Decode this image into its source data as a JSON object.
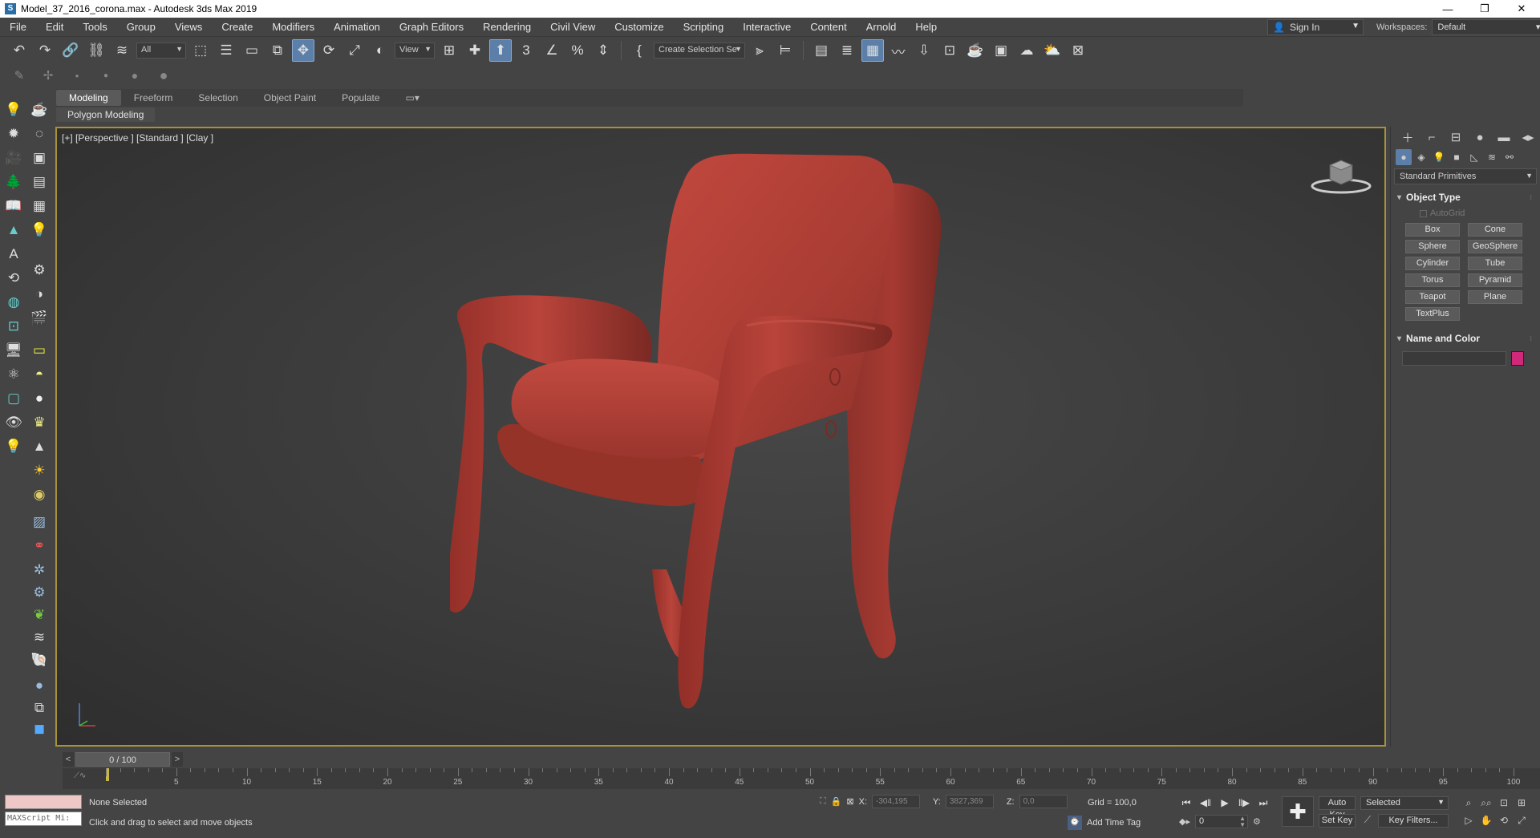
{
  "window": {
    "title": "Model_37_2016_corona.max - Autodesk 3ds Max 2019",
    "controls": [
      "—",
      "❐",
      "✕"
    ]
  },
  "menu": [
    "File",
    "Edit",
    "Tools",
    "Group",
    "Views",
    "Create",
    "Modifiers",
    "Animation",
    "Graph Editors",
    "Rendering",
    "Civil View",
    "Customize",
    "Scripting",
    "Interactive",
    "Content",
    "Arnold",
    "Help"
  ],
  "account": {
    "sign_in": "Sign In"
  },
  "workspaces": {
    "label": "Workspaces:",
    "value": "Default"
  },
  "toolbar": {
    "filter_value": "All",
    "ref_coord_value": "View",
    "selection_set_value": "Create Selection Se"
  },
  "ribbon": {
    "tabs": [
      "Modeling",
      "Freeform",
      "Selection",
      "Object Paint",
      "Populate"
    ],
    "active_tab": "Modeling",
    "panel_label": "Polygon Modeling"
  },
  "viewport": {
    "label": "[+] [Perspective ] [Standard ] [Clay ]"
  },
  "command_panel": {
    "primitives_dropdown": "Standard Primitives",
    "object_type_title": "Object Type",
    "autogrid_label": "AutoGrid",
    "object_buttons": [
      "Box",
      "Cone",
      "Sphere",
      "GeoSphere",
      "Cylinder",
      "Tube",
      "Torus",
      "Pyramid",
      "Teapot",
      "Plane",
      "TextPlus"
    ],
    "name_color_title": "Name and Color",
    "object_color": "#d0287a"
  },
  "timeline": {
    "frame_display": "0 / 100",
    "ticks": [
      "5",
      "10",
      "15",
      "20",
      "25",
      "30",
      "35",
      "40",
      "45",
      "50",
      "55",
      "60",
      "65",
      "70",
      "75",
      "80",
      "85",
      "90",
      "95",
      "100"
    ]
  },
  "status": {
    "selection": "None Selected",
    "prompt": "Click and drag to select and move objects",
    "maxscript": "MAXScript Mi:",
    "x_label": "X:",
    "x_value": "-304,195",
    "y_label": "Y:",
    "y_value": "3827,369",
    "z_label": "Z:",
    "z_value": "0,0",
    "grid": "Grid = 100,0",
    "add_time_tag": "Add Time Tag",
    "auto_key": "Auto Key",
    "set_key": "Set Key",
    "selected_dd": "Selected",
    "key_filters": "Key Filters...",
    "current_frame": "0"
  },
  "colors": {
    "chair": "#b04038",
    "viewport_border": "#a7923a",
    "accent_blue": "#5b7fa8"
  }
}
